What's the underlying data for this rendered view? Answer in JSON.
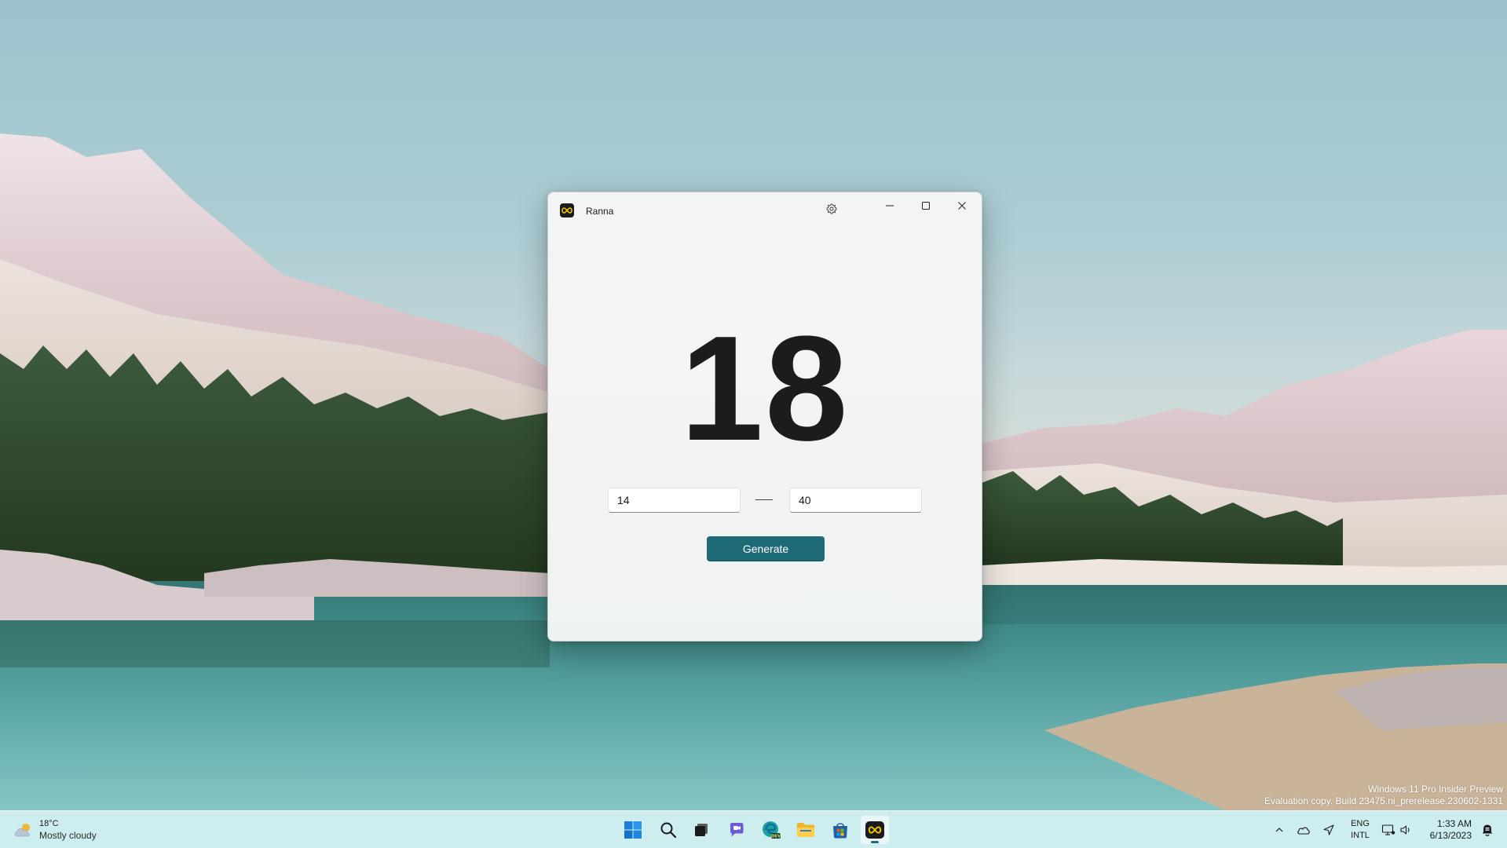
{
  "desktop": {
    "watermark_line1": "Windows 11 Pro Insider Preview",
    "watermark_line2": "Evaluation copy. Build 23475.ni_prerelease.230602-1331"
  },
  "window": {
    "title": "Ranna",
    "icon": "infinity-icon",
    "settings_icon": "gear-icon",
    "minimize_icon": "minimize-icon",
    "maximize_icon": "maximize-icon",
    "close_icon": "close-icon",
    "result": "18",
    "range_min": "14",
    "range_max": "40",
    "generate_label": "Generate",
    "accent_color": "#1f6a77"
  },
  "taskbar": {
    "weather": {
      "temperature": "18°C",
      "description": "Mostly cloudy",
      "icon": "partly-cloudy-icon"
    },
    "apps": [
      {
        "name": "start",
        "icon": "windows-logo-icon"
      },
      {
        "name": "search",
        "icon": "search-icon"
      },
      {
        "name": "task-view",
        "icon": "task-view-icon"
      },
      {
        "name": "chat",
        "icon": "chat-icon"
      },
      {
        "name": "edge-dev",
        "icon": "edge-dev-icon"
      },
      {
        "name": "file-explorer",
        "icon": "folder-icon"
      },
      {
        "name": "store",
        "icon": "store-icon"
      },
      {
        "name": "ranna",
        "icon": "infinity-icon",
        "active": true
      }
    ],
    "tray": {
      "language_line1": "ENG",
      "language_line2": "INTL",
      "time": "1:33 AM",
      "date": "6/13/2023"
    }
  }
}
